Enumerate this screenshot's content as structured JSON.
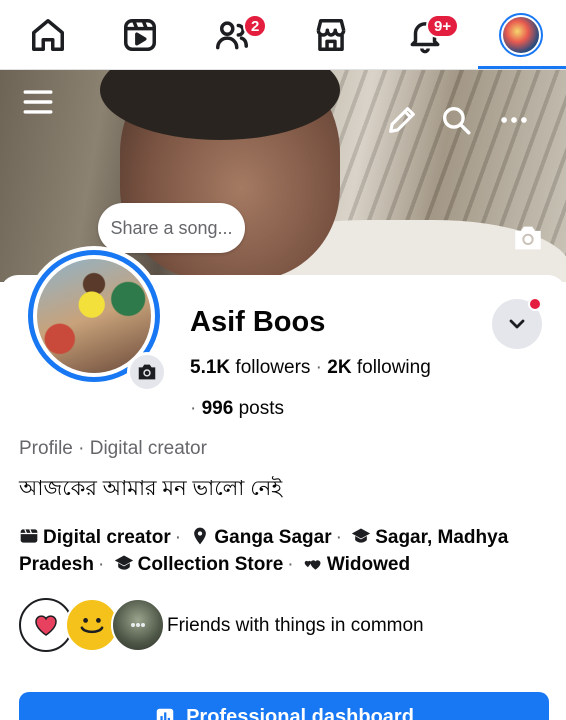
{
  "nav": {
    "items": [
      {
        "icon": "home-icon"
      },
      {
        "icon": "video-icon"
      },
      {
        "icon": "friends-icon",
        "badge": "2"
      },
      {
        "icon": "marketplace-icon"
      },
      {
        "icon": "bell-icon",
        "badge": "9+"
      },
      {
        "icon": "profile-avatar-icon",
        "active": true
      }
    ]
  },
  "cover": {
    "song_prompt": "Share a song...",
    "icons": [
      "menu-icon",
      "edit-icon",
      "search-icon",
      "more-icon",
      "camera-icon"
    ]
  },
  "profile": {
    "name": "Asif Boos",
    "followers_count": "5.1K",
    "followers_label": " followers",
    "following_count": "2K",
    "following_label": " following",
    "posts_count": "996",
    "posts_label": " posts",
    "category": "Profile · Digital creator",
    "bio": "আজকের আমার মন ভালো নেই"
  },
  "details": [
    {
      "icon": "clapper-icon",
      "text": "Digital creator"
    },
    {
      "icon": "location-icon",
      "text": "Ganga Sagar"
    },
    {
      "icon": "graduation-cap-icon",
      "text": "Sagar, Madhya Pradesh"
    },
    {
      "icon": "graduation-cap-icon",
      "text": "Collection Store"
    },
    {
      "icon": "heart-icon",
      "text": "Widowed"
    }
  ],
  "friends": {
    "text": "Friends with things in common"
  },
  "professional_dashboard": {
    "label": "Professional dashboard"
  },
  "colors": {
    "accent": "#1877f2",
    "badge": "#e41e3f"
  }
}
